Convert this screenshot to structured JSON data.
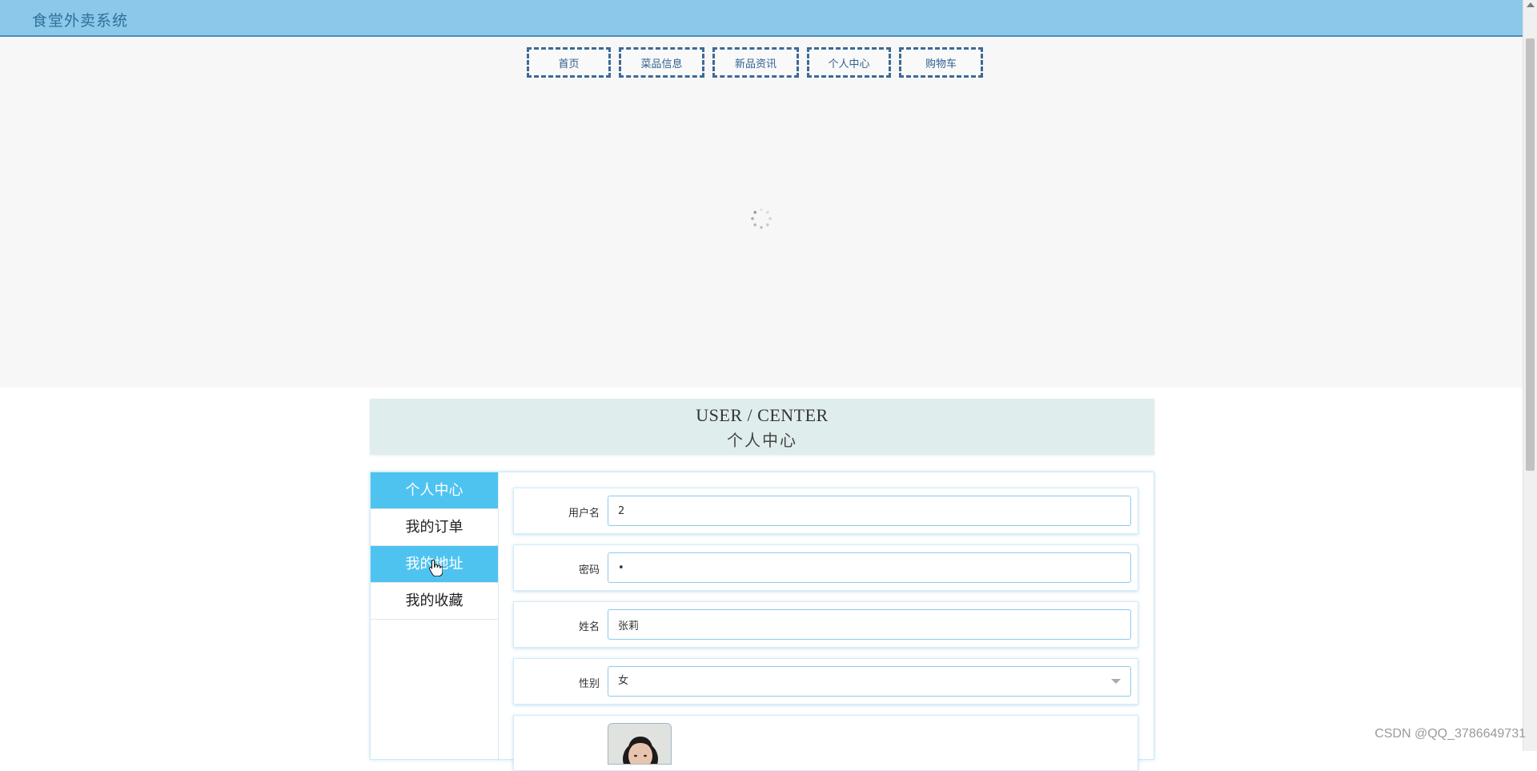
{
  "header": {
    "title": "食堂外卖系统"
  },
  "nav": {
    "items": [
      {
        "label": "首页"
      },
      {
        "label": "菜品信息"
      },
      {
        "label": "新品资讯"
      },
      {
        "label": "个人中心"
      },
      {
        "label": "购物车"
      }
    ]
  },
  "section": {
    "title_en": "USER / CENTER",
    "title_cn": "个人中心"
  },
  "side_menu": {
    "items": [
      {
        "label": "个人中心",
        "active": true
      },
      {
        "label": "我的订单",
        "active": false
      },
      {
        "label": "我的地址",
        "active": true
      },
      {
        "label": "我的收藏",
        "active": false
      }
    ]
  },
  "form": {
    "username": {
      "label": "用户名",
      "value": "2"
    },
    "password": {
      "label": "密码",
      "value": "•"
    },
    "name": {
      "label": "姓名",
      "value": "张莉"
    },
    "gender": {
      "label": "性别",
      "value": "女"
    }
  },
  "colors": {
    "header_bg": "#8cc8ea",
    "accent": "#4fc3f0",
    "nav_border": "#3d6a96"
  },
  "watermark": "CSDN @QQ_3786649731"
}
